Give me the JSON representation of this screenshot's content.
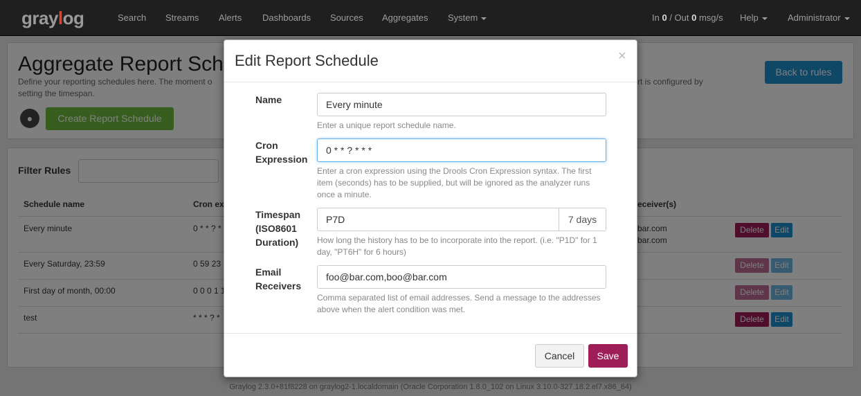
{
  "navbar": {
    "brand": "graylog",
    "items": [
      "Search",
      "Streams",
      "Alerts",
      "Dashboards",
      "Sources",
      "Aggregates",
      "System"
    ],
    "throughput": {
      "prefix": "In ",
      "in": "0",
      "sep": " / Out ",
      "out": "0",
      "suffix": " msg/s"
    },
    "help": "Help",
    "user": "Administrator"
  },
  "page": {
    "title": "Aggregate Report Schedules",
    "desc_left": "Define your reporting schedules here. The moment o",
    "desc_left2": "setting the timespan.",
    "desc_right": "rt is configured by",
    "create_button": "Create Report Schedule",
    "back_button": "Back to rules",
    "filter_label": "Filter Rules",
    "columns": [
      "Schedule name",
      "Cron ex",
      "eceiver(s)"
    ],
    "rows": [
      {
        "name": "Every minute",
        "cron": "0 * * ? *",
        "receivers": [
          "bar.com",
          "bar.com"
        ]
      },
      {
        "name": "Every Saturday, 23:59",
        "cron": "0 59 23",
        "receivers": []
      },
      {
        "name": "First day of month, 00:00",
        "cron": "0 0 0 1 1",
        "receivers": []
      },
      {
        "name": "test",
        "cron": "* * * ? *",
        "receivers": []
      }
    ],
    "delete_label": "Delete",
    "edit_label": "Edit",
    "footer": "Graylog 2.3.0+81f8228 on graylog2-1.localdomain (Oracle Corporation 1.8.0_102 on Linux 3.10.0-327.18.2.el7.x86_64)"
  },
  "modal": {
    "title": "Edit Report Schedule",
    "close": "×",
    "name": {
      "label": "Name",
      "value": "Every minute",
      "help": "Enter a unique report schedule name."
    },
    "cron": {
      "label_line1": "Cron",
      "label_line2": "Expression",
      "value": "0 * * ? * * *",
      "help": "Enter a cron expression using the Drools Cron Expression syntax. The first item (seconds) has to be supplied, but will be ignored as the analyzer runs once a minute."
    },
    "timespan": {
      "label_line1": "Timespan",
      "label_line2": "(ISO8601",
      "label_line3": "Duration)",
      "value": "P7D",
      "addon": "7 days",
      "help": "How long the history has to be to incorporate into the report. (i.e. \"P1D\" for 1 day, \"PT6H\" for 6 hours)"
    },
    "email": {
      "label_line1": "Email",
      "label_line2": "Receivers",
      "value": "foo@bar.com,boo@bar.com",
      "help": "Comma separated list of email addresses. Send a message to the addresses above when the alert condition was met."
    },
    "cancel": "Cancel",
    "save": "Save"
  }
}
